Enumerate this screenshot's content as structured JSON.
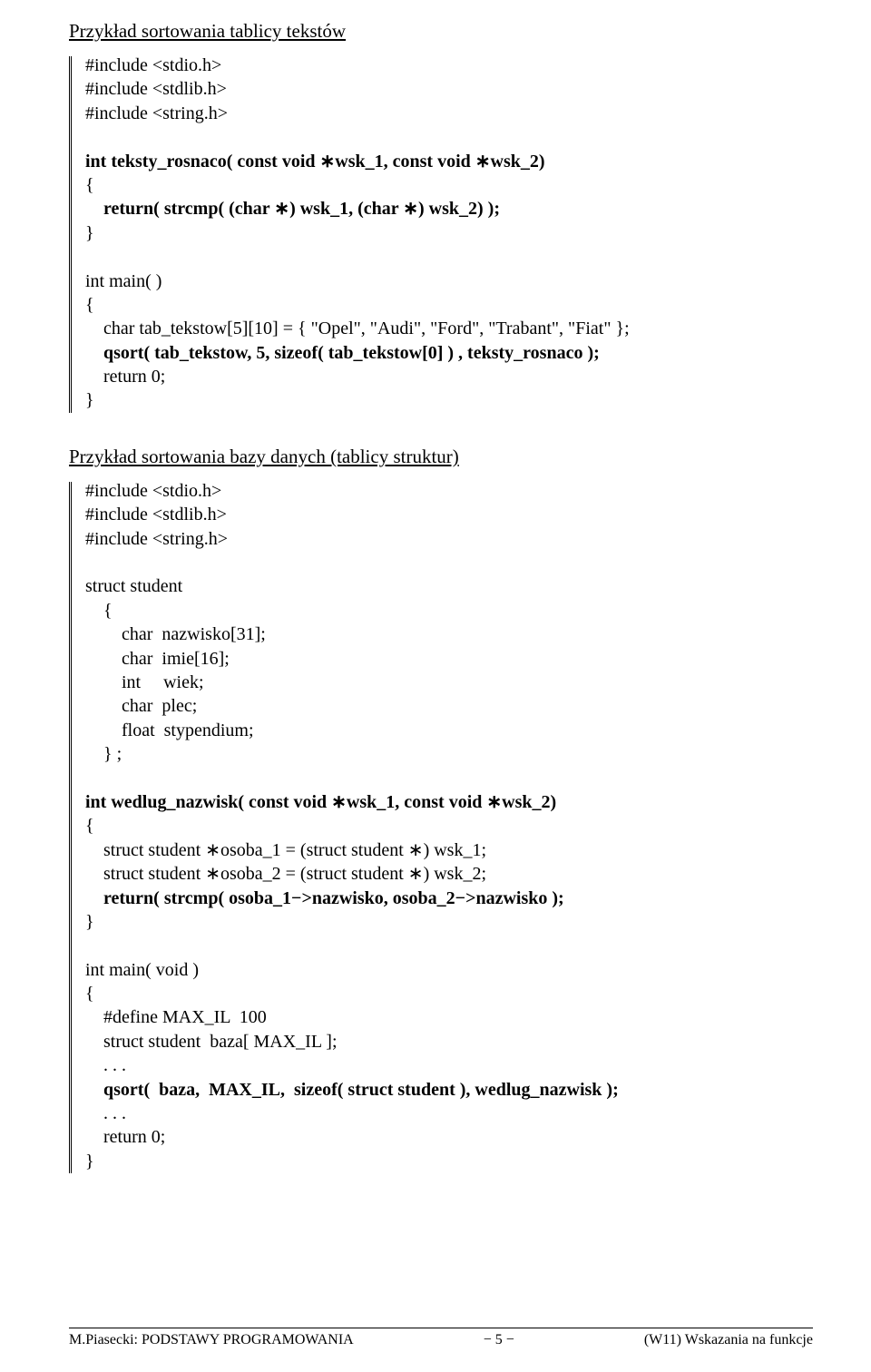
{
  "section1": {
    "title": "Przykład sortowania tablicy tekstów",
    "code": {
      "l1": "#include <stdio.h>",
      "l2": "#include <stdlib.h>",
      "l3": "#include <string.h>",
      "l4": "",
      "l5a": "int teksty_rosnaco( const void ",
      "l5b": "wsk_1, const void ",
      "l5c": "wsk_2)",
      "l6": "{",
      "l7a": "    return( strcmp( (char ",
      "l7b": ") wsk_1, (char ",
      "l7c": ") wsk_2) );",
      "l8": "}",
      "l9": "",
      "l10": "int main( )",
      "l11": "{",
      "l12": "    char tab_tekstow[5][10] = { \"Opel\", \"Audi\", \"Ford\", \"Trabant\", \"Fiat\" };",
      "l13": "    qsort( tab_tekstow, 5, sizeof( tab_tekstow[0] ) , teksty_rosnaco );",
      "l14": "    return 0;",
      "l15": "}"
    }
  },
  "section2": {
    "title": "Przykład sortowania bazy danych (tablicy struktur)",
    "code": {
      "l1": "#include <stdio.h>",
      "l2": "#include <stdlib.h>",
      "l3": "#include <string.h>",
      "l4": "",
      "l5": "struct student",
      "l6": "    {",
      "l7": "        char  nazwisko[31];",
      "l8": "        char  imie[16];",
      "l9": "        int     wiek;",
      "l10": "        char  plec;",
      "l11": "        float  stypendium;",
      "l12": "    } ;",
      "l13": "",
      "l14a": "int wedlug_nazwisk( const void ",
      "l14b": "wsk_1, const void ",
      "l14c": "wsk_2)",
      "l15": "{",
      "l16a": "    struct student ",
      "l16b": "osoba_1 = (struct student ",
      "l16c": ") wsk_1;",
      "l17a": "    struct student ",
      "l17b": "osoba_2 = (struct student ",
      "l17c": ") wsk_2;",
      "l18a": "    return( strcmp( osoba_1",
      "l18b": ">nazwisko, osoba_2",
      "l18c": ">nazwisko );",
      "l19": "}",
      "l20": "",
      "l21": "int main( void )",
      "l22": "{",
      "l23": "    #define MAX_IL  100",
      "l24": "    struct student  baza[ MAX_IL ];",
      "l25": "    . . .",
      "l26": "    qsort(  baza,  MAX_IL,  sizeof( struct student ), wedlug_nazwisk );",
      "l27": "    . . .",
      "l28": "    return 0;",
      "l29": "}"
    }
  },
  "footer": {
    "left": "M.Piasecki: PODSTAWY PROGRAMOWANIA",
    "center": "−  5  −",
    "right": "(W11) Wskazania na funkcje"
  },
  "glyphs": {
    "ast": "∗",
    "min": "−"
  }
}
